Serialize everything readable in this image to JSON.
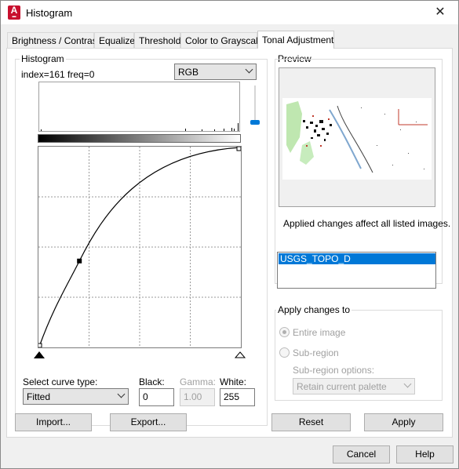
{
  "window": {
    "title": "Histogram",
    "close_glyph": "✕",
    "app_icon_letter": "A"
  },
  "tabs": [
    {
      "label": "Brightness / Contrast",
      "active": false
    },
    {
      "label": "Equalize",
      "active": false
    },
    {
      "label": "Threshold",
      "active": false
    },
    {
      "label": "Color to Grayscale",
      "active": false
    },
    {
      "label": "Tonal Adjustment",
      "active": true
    }
  ],
  "histogram": {
    "group_label": "Histogram",
    "info": "index=161 freq=0",
    "channel": "RGB",
    "curve_points": [
      [
        0,
        0
      ],
      [
        0.2,
        0.43
      ],
      [
        1,
        1
      ]
    ]
  },
  "curve_type": {
    "label": "Select curve type:",
    "value": "Fitted"
  },
  "levels": {
    "black_label": "Black:",
    "black_value": "0",
    "gamma_label": "Gamma:",
    "gamma_value": "1.00",
    "white_label": "White:",
    "white_value": "255"
  },
  "preview": {
    "group_label": "Preview",
    "note": "Applied changes affect all listed images.",
    "images": [
      "USGS_TOPO_D"
    ]
  },
  "apply_to": {
    "group_label": "Apply changes to",
    "entire_image": "Entire image",
    "entire_checked": true,
    "sub_region": "Sub-region",
    "sub_region_options_label": "Sub-region options:",
    "palette_option": "Retain current palette"
  },
  "buttons": {
    "import": "Import...",
    "export": "Export...",
    "reset": "Reset",
    "apply": "Apply",
    "cancel": "Cancel",
    "help": "Help"
  },
  "colors": {
    "selection": "#0078d7",
    "accent_slider": "#0078d7"
  }
}
